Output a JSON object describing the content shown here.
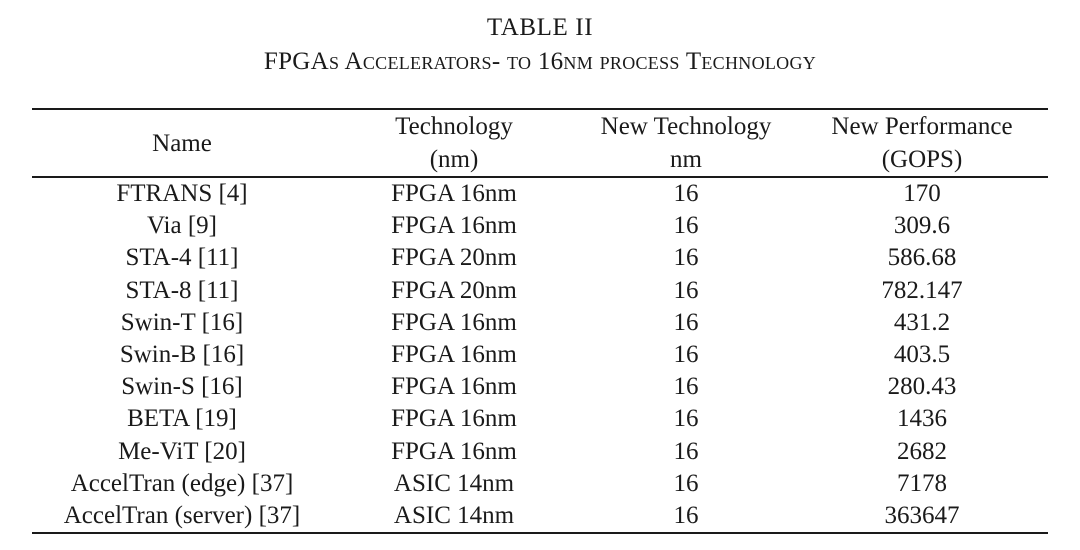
{
  "caption": {
    "title": "TABLE II",
    "subtitle": "FPGAs Accelerators- to 16nm process Technology"
  },
  "table": {
    "columns": [
      {
        "line1": "Name",
        "line2": ""
      },
      {
        "line1": "Technology",
        "line2": "(nm)"
      },
      {
        "line1": "New Technology",
        "line2": "nm"
      },
      {
        "line1": "New Performance",
        "line2": "(GOPS)"
      }
    ],
    "rows": [
      {
        "name": "FTRANS [4]",
        "technology": "FPGA 16nm",
        "new_technology": "16",
        "new_performance": "170"
      },
      {
        "name": "Via [9]",
        "technology": "FPGA 16nm",
        "new_technology": "16",
        "new_performance": "309.6"
      },
      {
        "name": "STA-4 [11]",
        "technology": "FPGA 20nm",
        "new_technology": "16",
        "new_performance": "586.68"
      },
      {
        "name": "STA-8 [11]",
        "technology": "FPGA 20nm",
        "new_technology": "16",
        "new_performance": "782.147"
      },
      {
        "name": "Swin-T [16]",
        "technology": "FPGA 16nm",
        "new_technology": "16",
        "new_performance": "431.2"
      },
      {
        "name": "Swin-B [16]",
        "technology": "FPGA 16nm",
        "new_technology": "16",
        "new_performance": "403.5"
      },
      {
        "name": "Swin-S [16]",
        "technology": "FPGA 16nm",
        "new_technology": "16",
        "new_performance": "280.43"
      },
      {
        "name": "BETA [19]",
        "technology": "FPGA 16nm",
        "new_technology": "16",
        "new_performance": "1436"
      },
      {
        "name": "Me-ViT [20]",
        "technology": "FPGA 16nm",
        "new_technology": "16",
        "new_performance": "2682"
      },
      {
        "name": "AccelTran (edge) [37]",
        "technology": "ASIC 14nm",
        "new_technology": "16",
        "new_performance": "7178"
      },
      {
        "name": "AccelTran (server) [37]",
        "technology": "ASIC 14nm",
        "new_technology": "16",
        "new_performance": "363647"
      }
    ]
  },
  "colors": {
    "text": "#1a1a1a",
    "background": "#ffffff",
    "rule": "#1a1a1a"
  }
}
